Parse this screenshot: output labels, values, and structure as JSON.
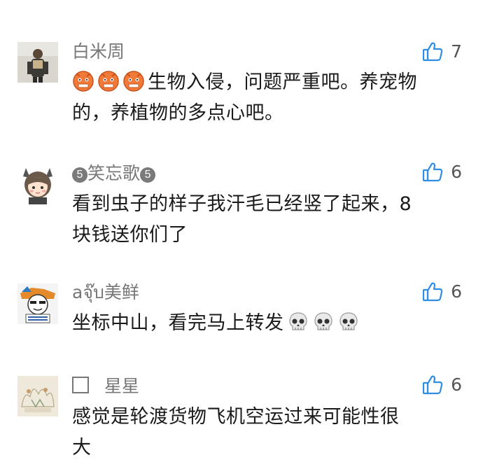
{
  "comments": [
    {
      "name": "白米周",
      "likes": "7",
      "lines": [
        "生物入侵，问题严重吧。养宠物",
        "的，养植物的多点心吧。"
      ],
      "emoji": "pouting-face-icon"
    },
    {
      "name_badge_left": "5",
      "name": "笑忘歌",
      "name_badge_right": "5",
      "likes": "6",
      "lines": [
        "看到虫子的样子我汗毛已经竖了起来，8",
        "块钱送你们了"
      ]
    },
    {
      "name": "aจุ๊บ美鲜",
      "likes": "6",
      "lines": [
        "坐标中山，看完马上转发"
      ],
      "emoji": "skull-icon"
    },
    {
      "name": "星星",
      "likes": "6",
      "lines": [
        "感觉是轮渡货物飞机空运过来可能性很",
        "大"
      ]
    }
  ],
  "colors": {
    "name": "#777777",
    "text": "#1a1a1a",
    "like_icon": "#2f8de4"
  }
}
